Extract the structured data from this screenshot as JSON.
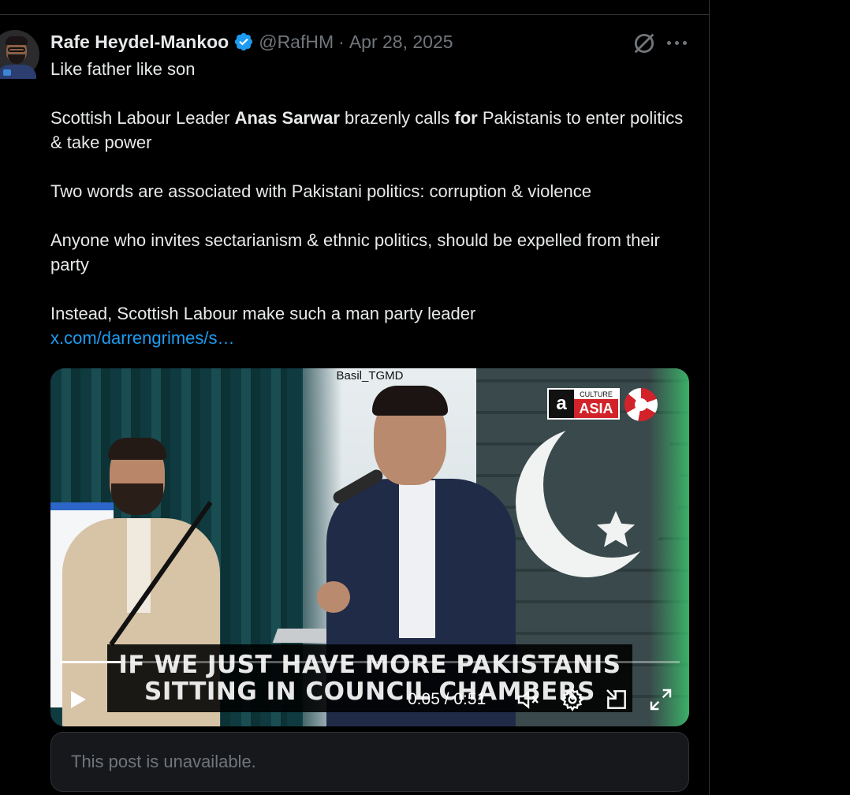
{
  "post": {
    "author_name": "Rafe Heydel-Mankoo",
    "handle": "@RafHM",
    "separator": "·",
    "date": "Apr 28, 2025",
    "verified_icon": "verified-badge-icon",
    "grok_icon": "grok-icon",
    "more_icon": "more-options-icon",
    "text": {
      "line1": "Like father like son",
      "p2_a": "Scottish Labour Leader ",
      "p2_b": "Anas Sarwar",
      "p2_c": " brazenly calls ",
      "p2_d": "for",
      "p2_e": " Pakistanis to enter politics & take power",
      "p3": "Two words are associated with Pakistani politics: corruption & violence",
      "p4": "Anyone who invites sectarianism & ethnic politics, should be expelled from their party",
      "p5": "Instead, Scottish Labour make such a man party leader",
      "link": "x.com/darrengrimes/s…"
    }
  },
  "video": {
    "watermark": "Basil_TGMD",
    "logo_culture": "CULTURE",
    "logo_asia": "ASIA",
    "logo_letter": "a",
    "caption_line1": "IF WE JUST HAVE MORE PAKISTANIS",
    "caption_line2": "SITTING IN COUNCIL CHAMBERS",
    "time": "0:05 / 0:51",
    "progress": 0.098,
    "controls": [
      "play-icon",
      "mute-icon",
      "settings-gear-icon",
      "picture-in-picture-icon",
      "fullscreen-icon"
    ]
  },
  "quoted_post": {
    "text": "This post is unavailable."
  },
  "colors": {
    "background": "#000000",
    "text": "#e7e9ea",
    "muted": "#71767b",
    "link": "#1d9bf0",
    "verified": "#1d9bf0"
  }
}
